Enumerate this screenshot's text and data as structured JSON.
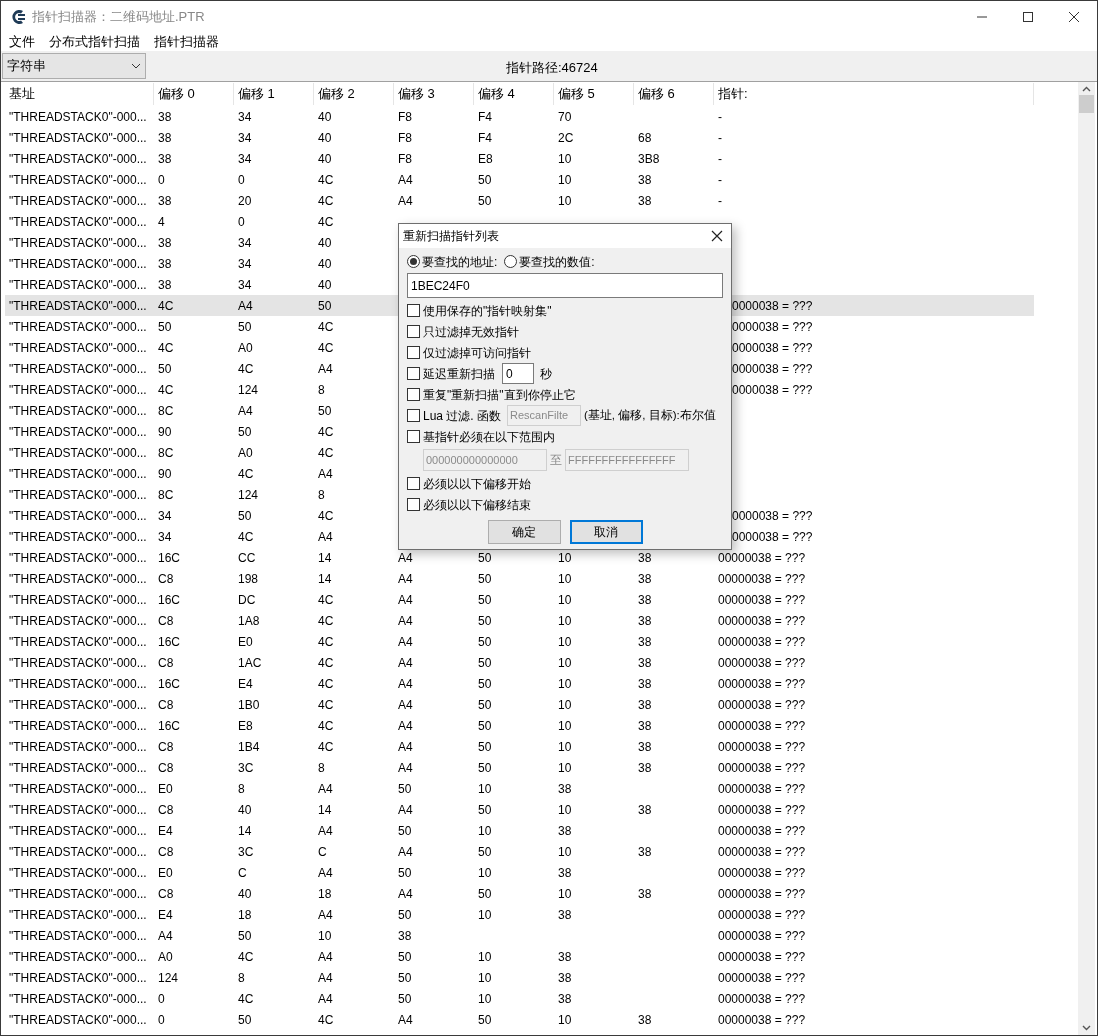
{
  "window": {
    "title": "指针扫描器：二维码地址.PTR"
  },
  "menu": [
    "文件",
    "分布式指针扫描",
    "指针扫描器"
  ],
  "toolbar": {
    "type_select": "字符串",
    "path_count": "指针路径:46724"
  },
  "table": {
    "columns": [
      "基址",
      "偏移 0",
      "偏移 1",
      "偏移 2",
      "偏移 3",
      "偏移 4",
      "偏移 5",
      "偏移 6",
      "指针:"
    ],
    "rows": [
      {
        "base": "\"THREADSTACK0\"-000...",
        "offsets": [
          "38",
          "34",
          "40",
          "F8",
          "F4",
          "70"
        ],
        "pointer": "-",
        "selected": false
      },
      {
        "base": "\"THREADSTACK0\"-000...",
        "offsets": [
          "38",
          "34",
          "40",
          "F8",
          "F4",
          "2C",
          "68"
        ],
        "pointer": "-",
        "selected": false
      },
      {
        "base": "\"THREADSTACK0\"-000...",
        "offsets": [
          "38",
          "34",
          "40",
          "F8",
          "E8",
          "10",
          "3B8"
        ],
        "pointer": "-",
        "selected": false
      },
      {
        "base": "\"THREADSTACK0\"-000...",
        "offsets": [
          "0",
          "0",
          "4C",
          "A4",
          "50",
          "10",
          "38"
        ],
        "pointer": "-",
        "selected": false
      },
      {
        "base": "\"THREADSTACK0\"-000...",
        "offsets": [
          "38",
          "20",
          "4C",
          "A4",
          "50",
          "10",
          "38"
        ],
        "pointer": "-",
        "selected": false
      },
      {
        "base": "\"THREADSTACK0\"-000...",
        "offsets": [
          "4",
          "0",
          "4C"
        ],
        "selected": false
      },
      {
        "base": "\"THREADSTACK0\"-000...",
        "offsets": [
          "38",
          "34",
          "40"
        ],
        "selected": false
      },
      {
        "base": "\"THREADSTACK0\"-000...",
        "offsets": [
          "38",
          "34",
          "40"
        ],
        "selected": false
      },
      {
        "base": "\"THREADSTACK0\"-000...",
        "offsets": [
          "38",
          "34",
          "40"
        ],
        "selected": false
      },
      {
        "base": "\"THREADSTACK0\"-000...",
        "offsets": [
          "4C",
          "A4",
          "50"
        ],
        "pointer": "0000038 = ???",
        "pointer_cut": true,
        "selected": true
      },
      {
        "base": "\"THREADSTACK0\"-000...",
        "offsets": [
          "50",
          "50",
          "4C"
        ],
        "pointer": "0000038 = ???",
        "pointer_cut": true,
        "selected": false
      },
      {
        "base": "\"THREADSTACK0\"-000...",
        "offsets": [
          "4C",
          "A0",
          "4C"
        ],
        "pointer": "0000038 = ???",
        "pointer_cut": true,
        "selected": false
      },
      {
        "base": "\"THREADSTACK0\"-000...",
        "offsets": [
          "50",
          "4C",
          "A4"
        ],
        "pointer": "0000038 = ???",
        "pointer_cut": true,
        "selected": false
      },
      {
        "base": "\"THREADSTACK0\"-000...",
        "offsets": [
          "4C",
          "124",
          "8"
        ],
        "pointer": "0000038 = ???",
        "pointer_cut": true,
        "selected": false
      },
      {
        "base": "\"THREADSTACK0\"-000...",
        "offsets": [
          "8C",
          "A4",
          "50"
        ],
        "selected": false
      },
      {
        "base": "\"THREADSTACK0\"-000...",
        "offsets": [
          "90",
          "50",
          "4C"
        ],
        "selected": false
      },
      {
        "base": "\"THREADSTACK0\"-000...",
        "offsets": [
          "8C",
          "A0",
          "4C"
        ],
        "selected": false
      },
      {
        "base": "\"THREADSTACK0\"-000...",
        "offsets": [
          "90",
          "4C",
          "A4"
        ],
        "selected": false
      },
      {
        "base": "\"THREADSTACK0\"-000...",
        "offsets": [
          "8C",
          "124",
          "8"
        ],
        "selected": false
      },
      {
        "base": "\"THREADSTACK0\"-000...",
        "offsets": [
          "34",
          "50",
          "4C"
        ],
        "pointer": "0000038 = ???",
        "pointer_cut": true,
        "selected": false
      },
      {
        "base": "\"THREADSTACK0\"-000...",
        "offsets": [
          "34",
          "4C",
          "A4"
        ],
        "pointer": "0000038 = ???",
        "pointer_cut": true,
        "selected": false
      },
      {
        "base": "\"THREADSTACK0\"-000...",
        "offsets": [
          "16C",
          "CC",
          "14",
          "A4",
          "50",
          "10",
          "38"
        ],
        "pointer": "00000038 = ???",
        "selected": false
      },
      {
        "base": "\"THREADSTACK0\"-000...",
        "offsets": [
          "C8",
          "198",
          "14",
          "A4",
          "50",
          "10",
          "38"
        ],
        "pointer": "00000038 = ???",
        "selected": false
      },
      {
        "base": "\"THREADSTACK0\"-000...",
        "offsets": [
          "16C",
          "DC",
          "4C",
          "A4",
          "50",
          "10",
          "38"
        ],
        "pointer": "00000038 = ???",
        "selected": false
      },
      {
        "base": "\"THREADSTACK0\"-000...",
        "offsets": [
          "C8",
          "1A8",
          "4C",
          "A4",
          "50",
          "10",
          "38"
        ],
        "pointer": "00000038 = ???",
        "selected": false
      },
      {
        "base": "\"THREADSTACK0\"-000...",
        "offsets": [
          "16C",
          "E0",
          "4C",
          "A4",
          "50",
          "10",
          "38"
        ],
        "pointer": "00000038 = ???",
        "selected": false
      },
      {
        "base": "\"THREADSTACK0\"-000...",
        "offsets": [
          "C8",
          "1AC",
          "4C",
          "A4",
          "50",
          "10",
          "38"
        ],
        "pointer": "00000038 = ???",
        "selected": false
      },
      {
        "base": "\"THREADSTACK0\"-000...",
        "offsets": [
          "16C",
          "E4",
          "4C",
          "A4",
          "50",
          "10",
          "38"
        ],
        "pointer": "00000038 = ???",
        "selected": false
      },
      {
        "base": "\"THREADSTACK0\"-000...",
        "offsets": [
          "C8",
          "1B0",
          "4C",
          "A4",
          "50",
          "10",
          "38"
        ],
        "pointer": "00000038 = ???",
        "selected": false
      },
      {
        "base": "\"THREADSTACK0\"-000...",
        "offsets": [
          "16C",
          "E8",
          "4C",
          "A4",
          "50",
          "10",
          "38"
        ],
        "pointer": "00000038 = ???",
        "selected": false
      },
      {
        "base": "\"THREADSTACK0\"-000...",
        "offsets": [
          "C8",
          "1B4",
          "4C",
          "A4",
          "50",
          "10",
          "38"
        ],
        "pointer": "00000038 = ???",
        "selected": false
      },
      {
        "base": "\"THREADSTACK0\"-000...",
        "offsets": [
          "C8",
          "3C",
          "8",
          "A4",
          "50",
          "10",
          "38"
        ],
        "pointer": "00000038 = ???",
        "selected": false
      },
      {
        "base": "\"THREADSTACK0\"-000...",
        "offsets": [
          "E0",
          "8",
          "A4",
          "50",
          "10",
          "38"
        ],
        "pointer": "00000038 = ???",
        "selected": false
      },
      {
        "base": "\"THREADSTACK0\"-000...",
        "offsets": [
          "C8",
          "40",
          "14",
          "A4",
          "50",
          "10",
          "38"
        ],
        "pointer": "00000038 = ???",
        "selected": false
      },
      {
        "base": "\"THREADSTACK0\"-000...",
        "offsets": [
          "E4",
          "14",
          "A4",
          "50",
          "10",
          "38"
        ],
        "pointer": "00000038 = ???",
        "selected": false
      },
      {
        "base": "\"THREADSTACK0\"-000...",
        "offsets": [
          "C8",
          "3C",
          "C",
          "A4",
          "50",
          "10",
          "38"
        ],
        "pointer": "00000038 = ???",
        "selected": false
      },
      {
        "base": "\"THREADSTACK0\"-000...",
        "offsets": [
          "E0",
          "C",
          "A4",
          "50",
          "10",
          "38"
        ],
        "pointer": "00000038 = ???",
        "selected": false
      },
      {
        "base": "\"THREADSTACK0\"-000...",
        "offsets": [
          "C8",
          "40",
          "18",
          "A4",
          "50",
          "10",
          "38"
        ],
        "pointer": "00000038 = ???",
        "selected": false
      },
      {
        "base": "\"THREADSTACK0\"-000...",
        "offsets": [
          "E4",
          "18",
          "A4",
          "50",
          "10",
          "38"
        ],
        "pointer": "00000038 = ???",
        "selected": false
      },
      {
        "base": "\"THREADSTACK0\"-000...",
        "offsets": [
          "A4",
          "50",
          "10",
          "38"
        ],
        "pointer": "00000038 = ???",
        "selected": false
      },
      {
        "base": "\"THREADSTACK0\"-000...",
        "offsets": [
          "A0",
          "4C",
          "A4",
          "50",
          "10",
          "38"
        ],
        "pointer": "00000038 = ???",
        "selected": false
      },
      {
        "base": "\"THREADSTACK0\"-000...",
        "offsets": [
          "124",
          "8",
          "A4",
          "50",
          "10",
          "38"
        ],
        "pointer": "00000038 = ???",
        "selected": false
      },
      {
        "base": "\"THREADSTACK0\"-000...",
        "offsets": [
          "0",
          "4C",
          "A4",
          "50",
          "10",
          "38"
        ],
        "pointer": "00000038 = ???",
        "selected": false
      },
      {
        "base": "\"THREADSTACK0\"-000...",
        "offsets": [
          "0",
          "50",
          "4C",
          "A4",
          "50",
          "10",
          "38"
        ],
        "pointer": "00000038 = ???",
        "selected": false
      }
    ]
  },
  "dialog": {
    "title": "重新扫描指针列表",
    "targets": [
      {
        "label": "要查找的地址:",
        "selected": true
      },
      {
        "label": "要查找的数值:",
        "selected": false
      }
    ],
    "value": "1BEC24F0",
    "options": [
      {
        "kind": "check",
        "label": "使用保存的\"指针映射集\"",
        "checked": false
      },
      {
        "kind": "check",
        "label": "只过滤掉无效指针",
        "checked": false
      },
      {
        "kind": "check",
        "label": "仅过滤掉可访问指针",
        "checked": false
      },
      {
        "kind": "delay",
        "label": "延迟重新扫描",
        "value": "0",
        "unit": "秒",
        "checked": false
      },
      {
        "kind": "check",
        "label": "重复\"重新扫描\"直到你停止它",
        "checked": false
      },
      {
        "kind": "lua",
        "label": "Lua 过滤. 函数",
        "value": "RescanFilte",
        "suffix": "(基址, 偏移, 目标):布尔值",
        "checked": false
      },
      {
        "kind": "range",
        "label": "基指针必须在以下范围内",
        "from": "000000000000000",
        "separator": "至",
        "to": "FFFFFFFFFFFFFFFF",
        "checked": false
      },
      {
        "kind": "check",
        "label": "必须以以下偏移开始",
        "checked": false
      },
      {
        "kind": "check",
        "label": "必须以以下偏移结束",
        "checked": false
      }
    ],
    "buttons": [
      {
        "label": "确定",
        "focused": false
      },
      {
        "label": "取消",
        "focused": true
      }
    ]
  }
}
